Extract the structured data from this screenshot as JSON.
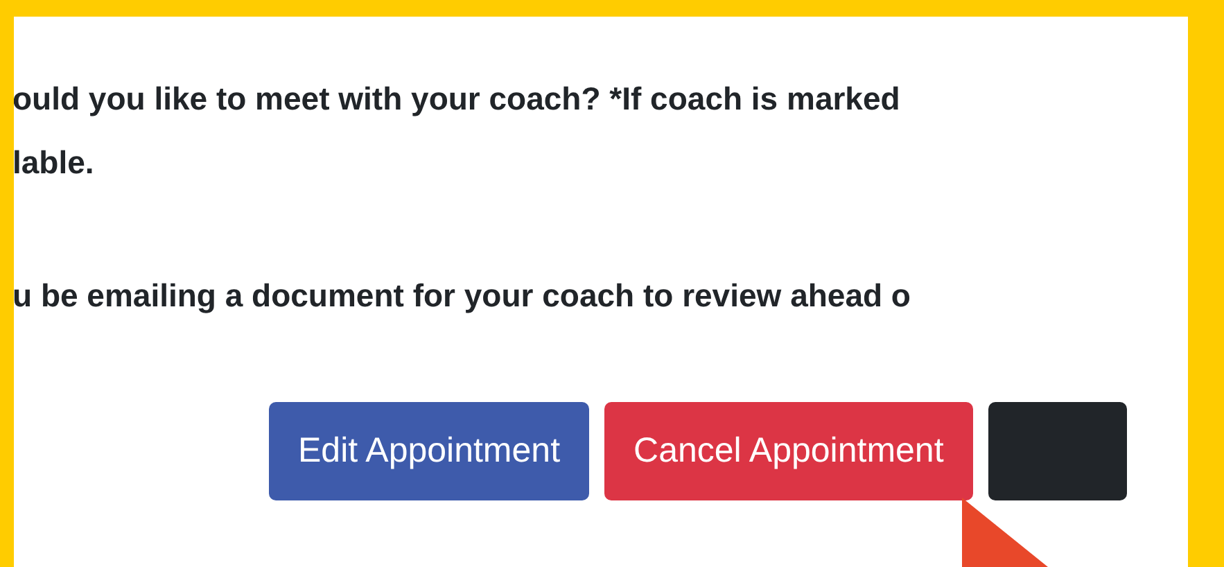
{
  "paragraphs": [
    {
      "lines": [
        "ould you like to meet with your coach? *If coach is marked",
        "lable."
      ]
    },
    {
      "lines": [
        "u be emailing a document for your coach to review ahead o"
      ]
    }
  ],
  "buttons": [
    {
      "kind": "primary",
      "label": "Edit Appointment"
    },
    {
      "kind": "danger",
      "label": "Cancel Appointment"
    },
    {
      "kind": "dark"
    }
  ]
}
